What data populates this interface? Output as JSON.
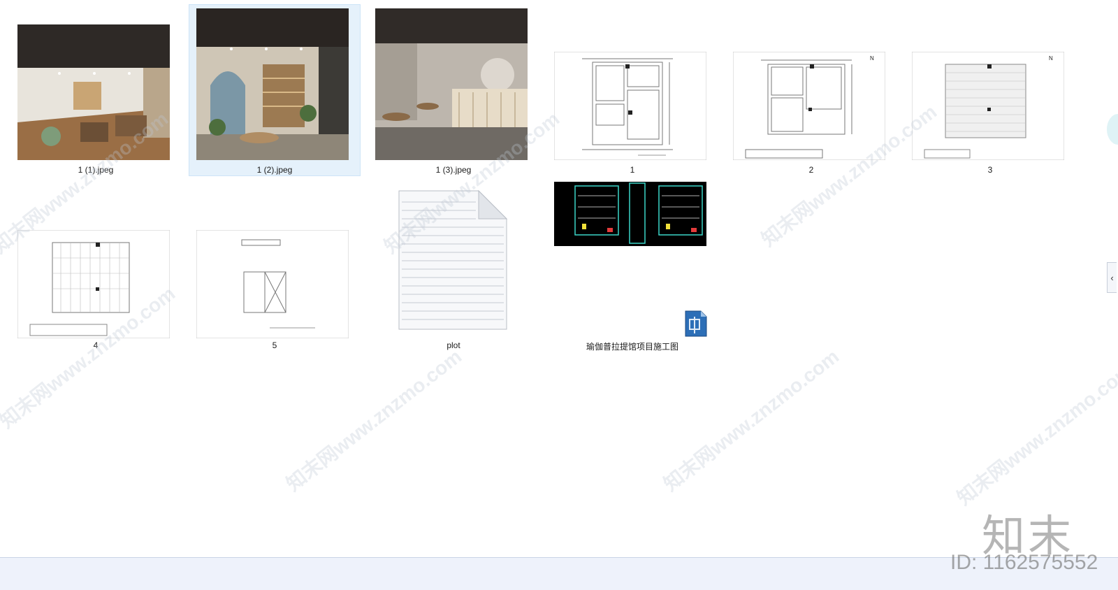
{
  "files": [
    {
      "name": "1 (1).jpeg",
      "kind": "photo-lounge",
      "selected": false
    },
    {
      "name": "1 (2).jpeg",
      "kind": "photo-arch",
      "selected": true
    },
    {
      "name": "1 (3).jpeg",
      "kind": "photo-reception",
      "selected": false
    },
    {
      "name": "1",
      "kind": "floorplan",
      "selected": false
    },
    {
      "name": "2",
      "kind": "floorplan",
      "selected": false
    },
    {
      "name": "3",
      "kind": "floorplan",
      "selected": false
    },
    {
      "name": "4",
      "kind": "floorplan",
      "selected": false
    },
    {
      "name": "5",
      "kind": "elevation",
      "selected": false
    },
    {
      "name": "plot",
      "kind": "text-document-icon",
      "selected": false
    },
    {
      "name": "瑜伽普拉提馆项目施工图",
      "kind": "cad-drawing",
      "selected": false
    }
  ],
  "watermark": {
    "site": "知末网www.znzmo.com",
    "brand": "知末",
    "id": "ID: 1162575552"
  },
  "panel_toggle_icon": "chevron-left-icon",
  "colors": {
    "selection": "#e5f1fb",
    "cad_bg": "#000000",
    "statusbar": "#eef2fb"
  }
}
